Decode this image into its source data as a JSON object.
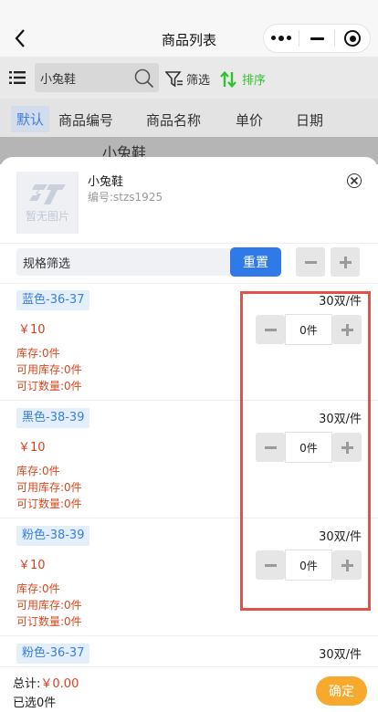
{
  "navbar": {
    "title": "商品列表",
    "back_icon": "chevron-left-icon"
  },
  "search": {
    "value": "小兔鞋",
    "filter_label": "筛选",
    "sort_label": "排序"
  },
  "tabs": [
    {
      "label": "默认",
      "active": true
    },
    {
      "label": "商品编号"
    },
    {
      "label": "商品名称"
    },
    {
      "label": "单价"
    },
    {
      "label": "日期"
    }
  ],
  "page_peek": "小兔鞋",
  "product": {
    "name": "小兔鞋",
    "code": "编号:stzs1925",
    "image_text": "暂无图片"
  },
  "spec_filter": {
    "value": "规格筛选",
    "reset_label": "重置"
  },
  "skus": [
    {
      "tag": "蓝色-36-37",
      "pack": "30双/件",
      "price": "￥10",
      "stock": "库存:0件",
      "available": "可用库存:0件",
      "orderable": "可订数量:0件",
      "qty": "0件"
    },
    {
      "tag": "黑色-38-39",
      "pack": "30双/件",
      "price": "￥10",
      "stock": "库存:0件",
      "available": "可用库存:0件",
      "orderable": "可订数量:0件",
      "qty": "0件"
    },
    {
      "tag": "粉色-38-39",
      "pack": "30双/件",
      "price": "￥10",
      "stock": "库存:0件",
      "available": "可用库存:0件",
      "orderable": "可订数量:0件",
      "qty": "0件"
    },
    {
      "tag": "粉色-36-37",
      "pack": "30双/件"
    }
  ],
  "footer": {
    "total_label": "总计:",
    "total_value": "￥0.00",
    "selected": "已选0件",
    "confirm_label": "确定"
  },
  "colors": {
    "accent": "#2f7ae6",
    "price": "#e03b1e",
    "confirm": "#f7a92e",
    "highlight": "#e0524a",
    "sort": "#2ec22e"
  }
}
